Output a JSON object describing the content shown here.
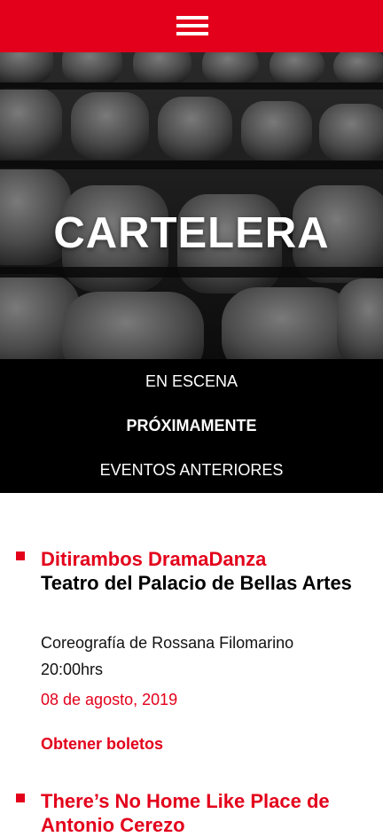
{
  "header": {
    "menu_icon": "hamburger-menu-icon",
    "accent_color": "#e3001b"
  },
  "hero": {
    "title": "CARTELERA"
  },
  "tabs": [
    {
      "label": "EN ESCENA",
      "active": false
    },
    {
      "label": "PRÓXIMAMENTE",
      "active": true
    },
    {
      "label": "EVENTOS ANTERIORES",
      "active": false
    }
  ],
  "events": [
    {
      "title": "Ditirambos DramaDanza",
      "venue": "Teatro del Palacio de Bellas Artes",
      "choreography": "Coreografía de Rossana Filomarino",
      "time": "20:00hrs",
      "date": "08 de agosto, 2019",
      "tickets_label": "Obtener boletos"
    },
    {
      "title": "There’s No Home Like Place de Antonio Cerezo"
    }
  ]
}
